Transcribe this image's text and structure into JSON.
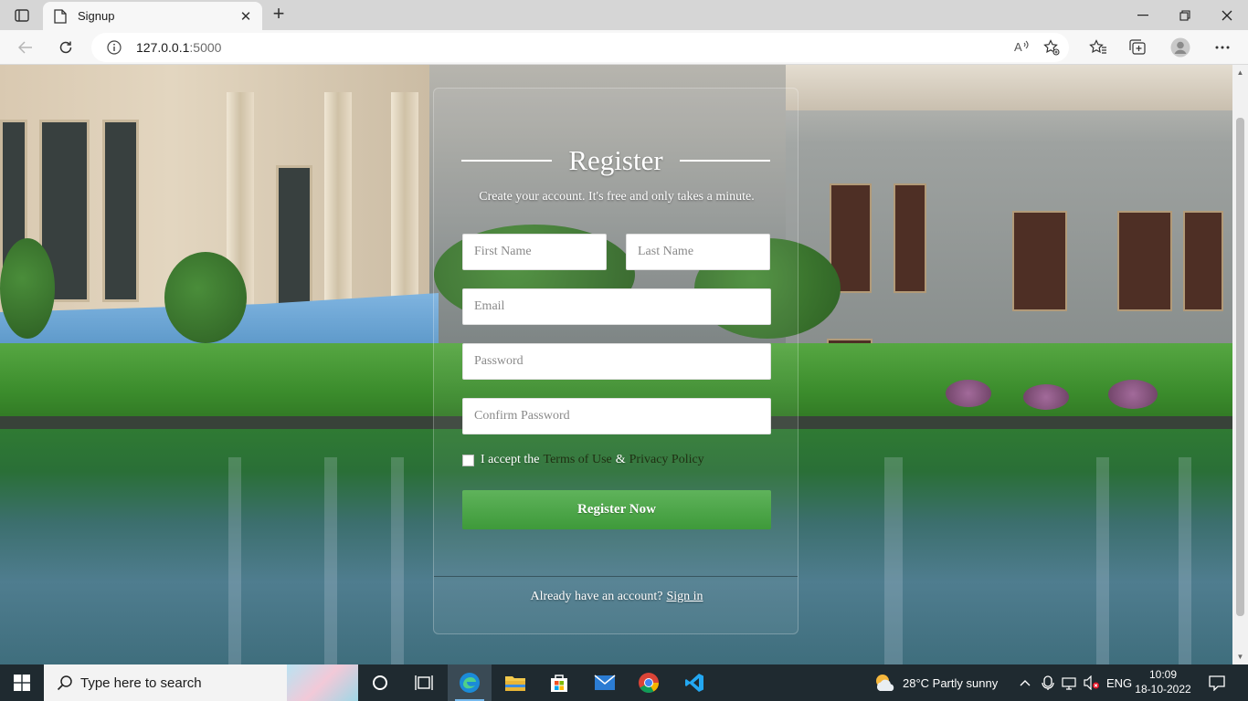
{
  "browser": {
    "tab_title": "Signup",
    "tab_close": "✕",
    "new_tab": "+",
    "url_host": "127.0.0.1",
    "url_port": ":5000"
  },
  "form": {
    "title": "Register",
    "subtitle": "Create your account. It's free and only takes a minute.",
    "first_name_placeholder": "First Name",
    "last_name_placeholder": "Last Name",
    "email_placeholder": "Email",
    "password_placeholder": "Password",
    "confirm_password_placeholder": "Confirm Password",
    "terms_prefix": "I accept the",
    "terms_link": "Terms of Use",
    "terms_amp": "&",
    "privacy_link": "Privacy Policy",
    "submit_label": "Register Now",
    "account_prompt": "Already have an account?",
    "sign_in_link": "Sign in"
  },
  "taskbar": {
    "search_placeholder": "Type here to search",
    "weather": "28°C  Partly sunny",
    "language": "ENG",
    "time": "10:09",
    "date": "18-10-2022"
  },
  "colors": {
    "register_button": "#4caf50",
    "tab_bar": "#d6d6d6",
    "taskbar": "#1f2a30"
  }
}
